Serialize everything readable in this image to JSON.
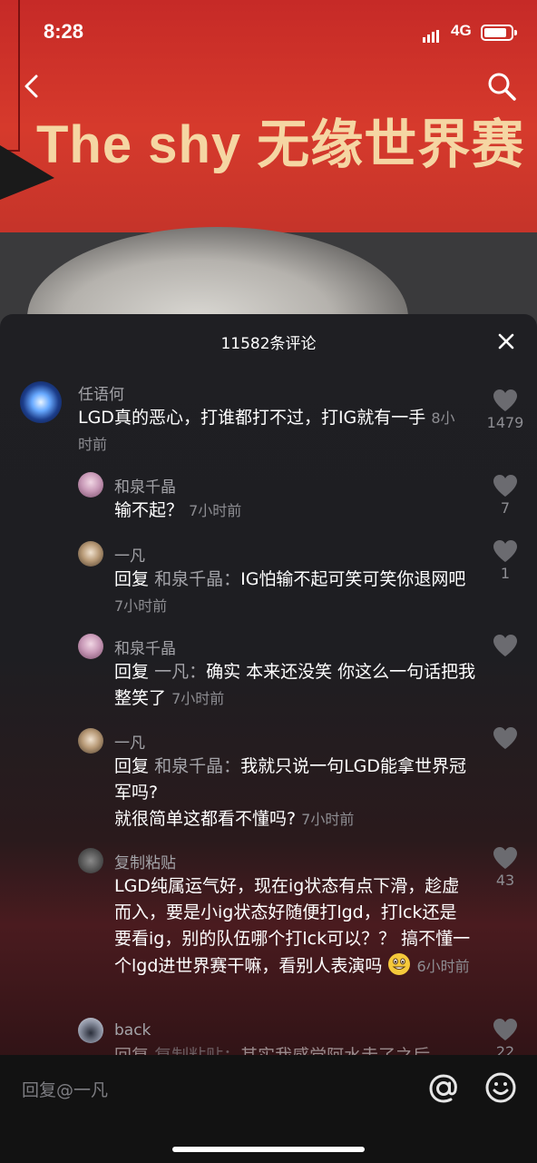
{
  "status": {
    "time": "8:28",
    "network": "4G"
  },
  "video": {
    "banner_title": "The shy 无缘世界赛"
  },
  "comments_panel": {
    "count_label": "11582条评论",
    "comments": [
      {
        "user": "任语何",
        "text": "LGD真的恶心，打谁都打不过，打IG就有一手",
        "time": "8小时前",
        "likes": "1479"
      },
      {
        "user": "和泉千晶",
        "text": "输不起？",
        "time": "7小时前",
        "likes": "7"
      },
      {
        "user": "一凡",
        "reply_prefix": "回复",
        "reply_to": "和泉千晶",
        "text": "IG怕输不起可笑可笑你退网吧",
        "time": "7小时前",
        "likes": "1"
      },
      {
        "user": "和泉千晶",
        "reply_prefix": "回复",
        "reply_to": "一凡",
        "text": "确实 本来还没笑 你这么一句话把我整笑了",
        "time": "7小时前",
        "likes": ""
      },
      {
        "user": "一凡",
        "reply_prefix": "回复",
        "reply_to": "和泉千晶",
        "text_line1": "我就只说一句LGD能拿世界冠军吗?",
        "text_line2": "就很简单这都看不懂吗?",
        "time": "7小时前",
        "likes": ""
      },
      {
        "user": "复制粘贴",
        "text": "LGD纯属运气好，现在ig状态有点下滑，趁虚而入，要是小ig状态好随便打lgd，打lck还是要看ig，别的队伍哪个打lck可以？？ 搞不懂一个lgd进世界赛干嘛，看别人表演吗",
        "time": "6小时前",
        "likes": "43"
      },
      {
        "user": "back",
        "reply_prefix": "回复",
        "reply_to": "复制粘贴",
        "text": "其实我感觉阿水走了之后",
        "likes": "22"
      }
    ]
  },
  "input": {
    "placeholder": "回复@一凡"
  },
  "icons": {
    "back": "chevron-left-icon",
    "search": "search-icon",
    "close": "close-icon",
    "like": "heart-icon",
    "at": "at-icon",
    "emoji": "emoji-icon"
  }
}
